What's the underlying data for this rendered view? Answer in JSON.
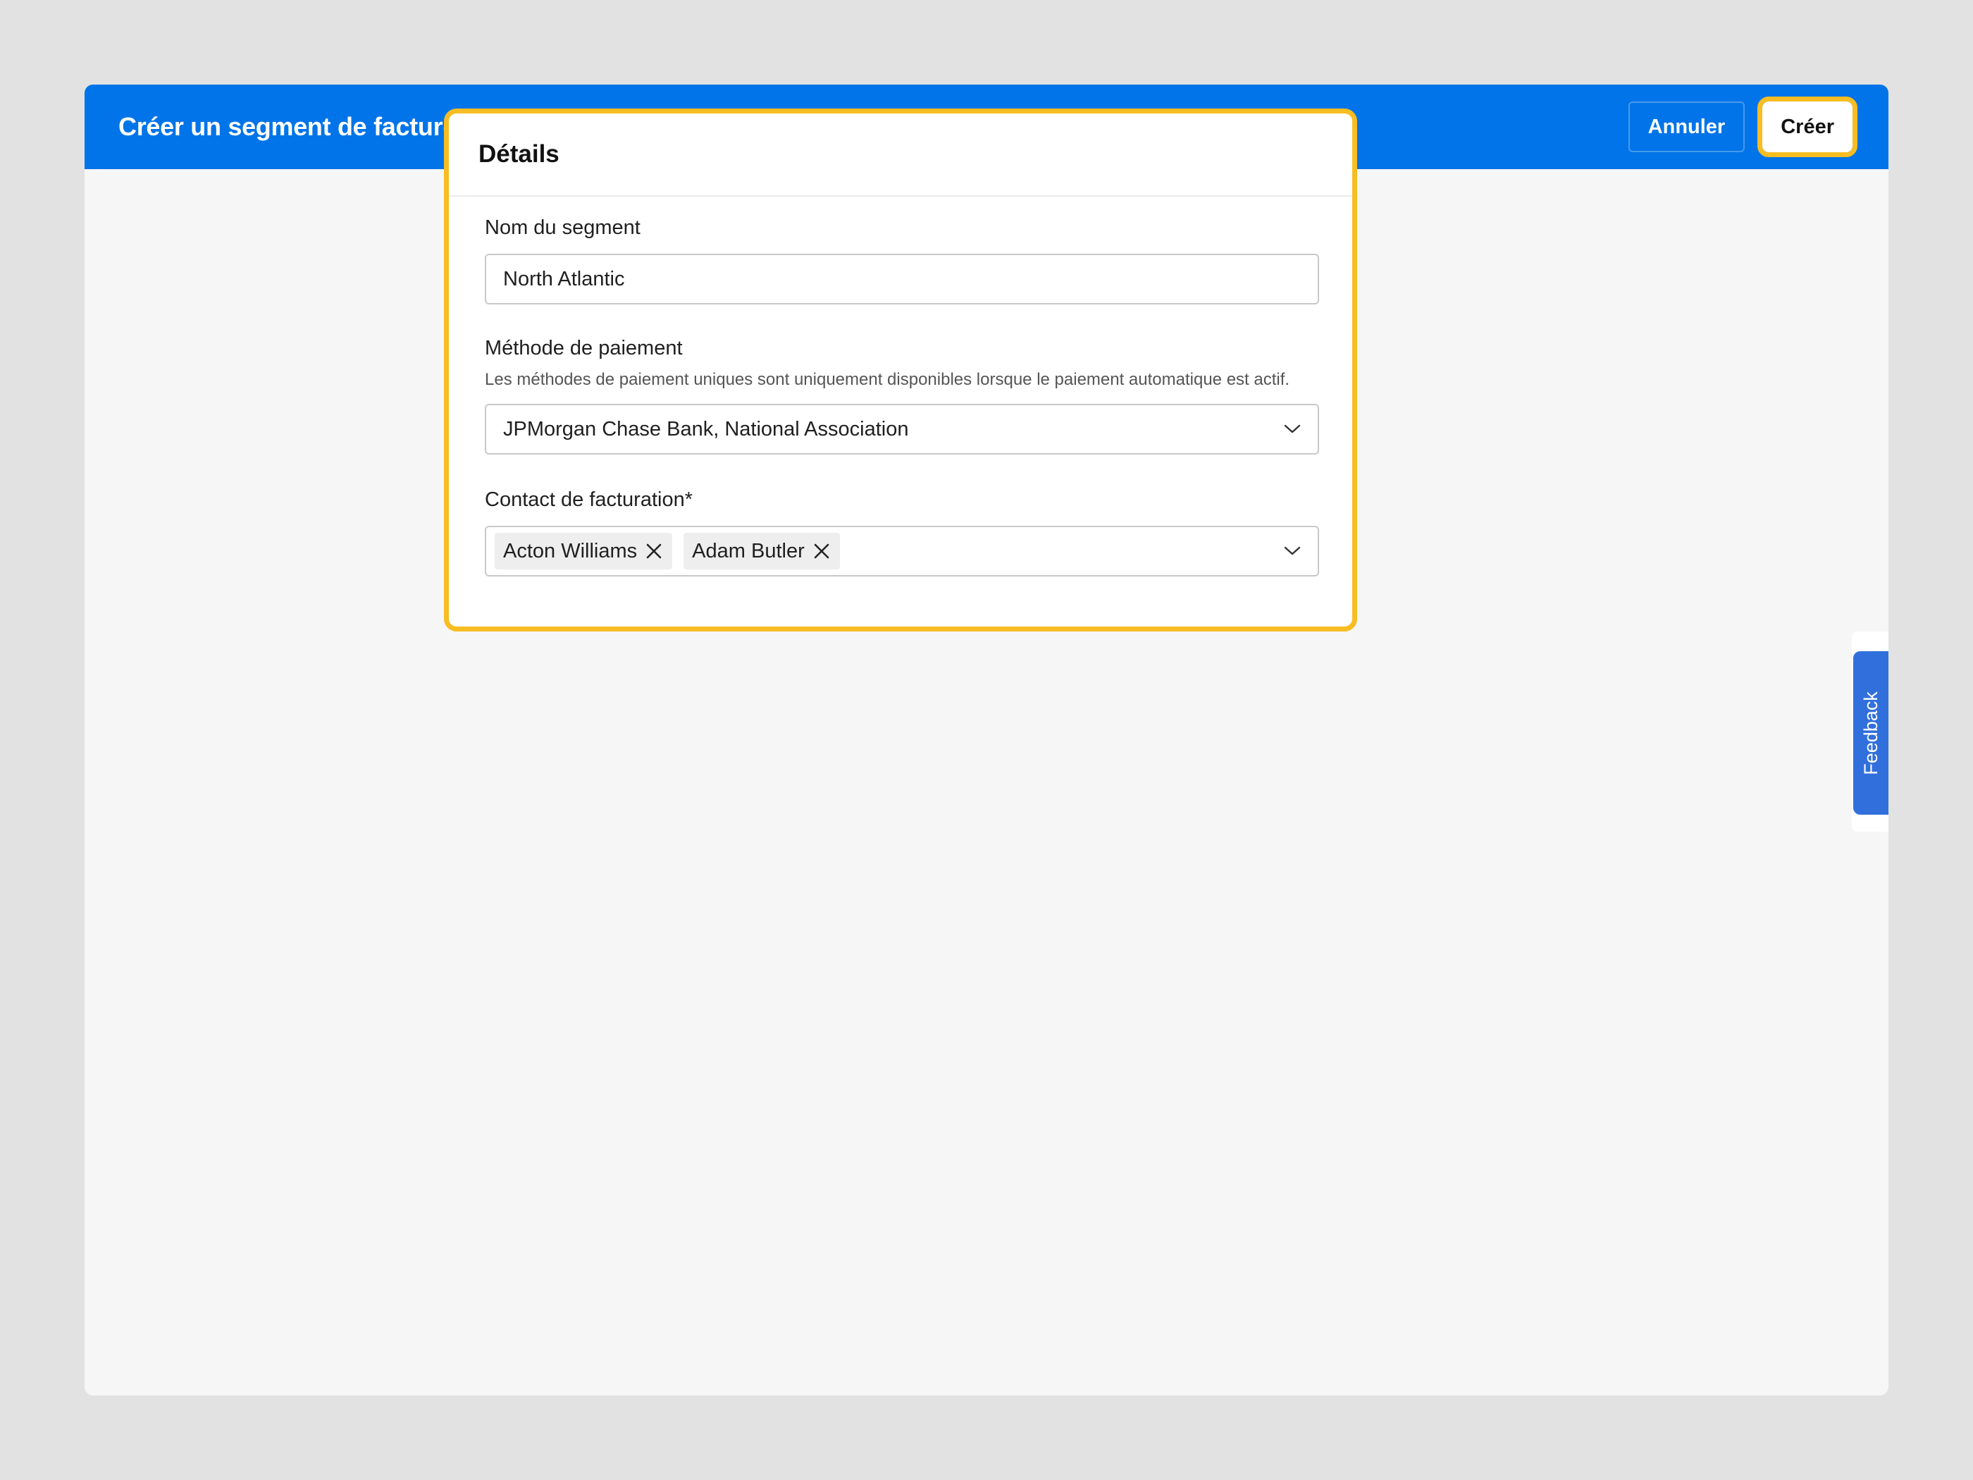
{
  "header": {
    "title": "Créer un segment de facture",
    "cancel_label": "Annuler",
    "create_label": "Créer"
  },
  "card": {
    "title": "Détails",
    "segment_name": {
      "label": "Nom du segment",
      "value": "North Atlantic"
    },
    "payment_method": {
      "label": "Méthode de paiement",
      "help": "Les méthodes de paiement uniques sont uniquement disponibles lorsque le paiement automatique est actif.",
      "selected": "JPMorgan Chase Bank, National Association"
    },
    "billing_contact": {
      "label": "Contact de facturation*",
      "tags": [
        "Acton Williams",
        "Adam Butler"
      ]
    }
  },
  "feedback_label": "Feedback",
  "icons": {
    "dropdown": "chevron-down-icon",
    "remove_tag": "close-icon"
  },
  "colors": {
    "header_bg": "#0074e8",
    "highlight": "#f7bd22",
    "feedback_bg": "#3170dc"
  }
}
